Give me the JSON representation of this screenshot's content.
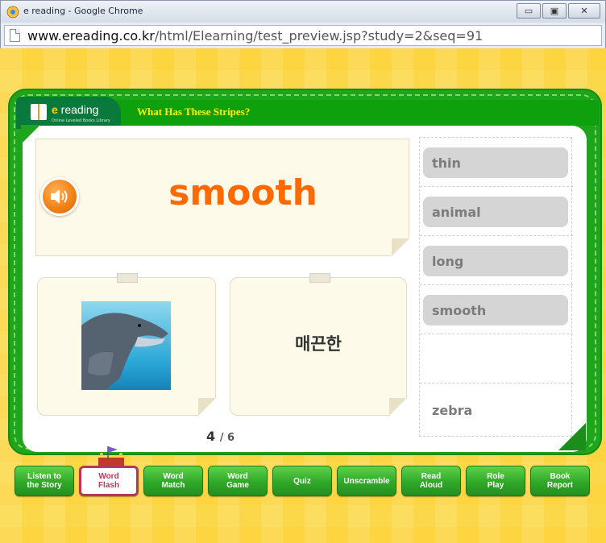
{
  "window": {
    "title": "e reading - Google Chrome",
    "minimize": "▭",
    "maximize": "▣",
    "close": "✕"
  },
  "address": {
    "host": "www.ereading.co.kr",
    "path": "/html/Elearning/test_preview.jsp?study=2&seq=91"
  },
  "app": {
    "logo_e": "e",
    "logo_text": " reading",
    "logo_sub": "Online Leveled Books Library",
    "story_title": "What Has These Stripes?"
  },
  "quiz": {
    "word": "smooth",
    "meaning": "매끈한",
    "current": "4",
    "total": "/ 6",
    "options": [
      "thin",
      "animal",
      "long",
      "smooth",
      "zebra"
    ]
  },
  "nav": {
    "buttons": [
      {
        "label": "Listen to\nthe Story",
        "active": false
      },
      {
        "label": "Word\nFlash",
        "active": true
      },
      {
        "label": "Word\nMatch",
        "active": false
      },
      {
        "label": "Word\nGame",
        "active": false
      },
      {
        "label": "Quiz",
        "active": false
      },
      {
        "label": "Unscramble",
        "active": false
      },
      {
        "label": "Read\nAloud",
        "active": false
      },
      {
        "label": "Role\nPlay",
        "active": false
      },
      {
        "label": "Book\nReport",
        "active": false
      }
    ]
  },
  "colors": {
    "word": "#ff6a00",
    "board": "#1fa51c",
    "title": "#fff200",
    "active_nav": "#b23a57"
  }
}
